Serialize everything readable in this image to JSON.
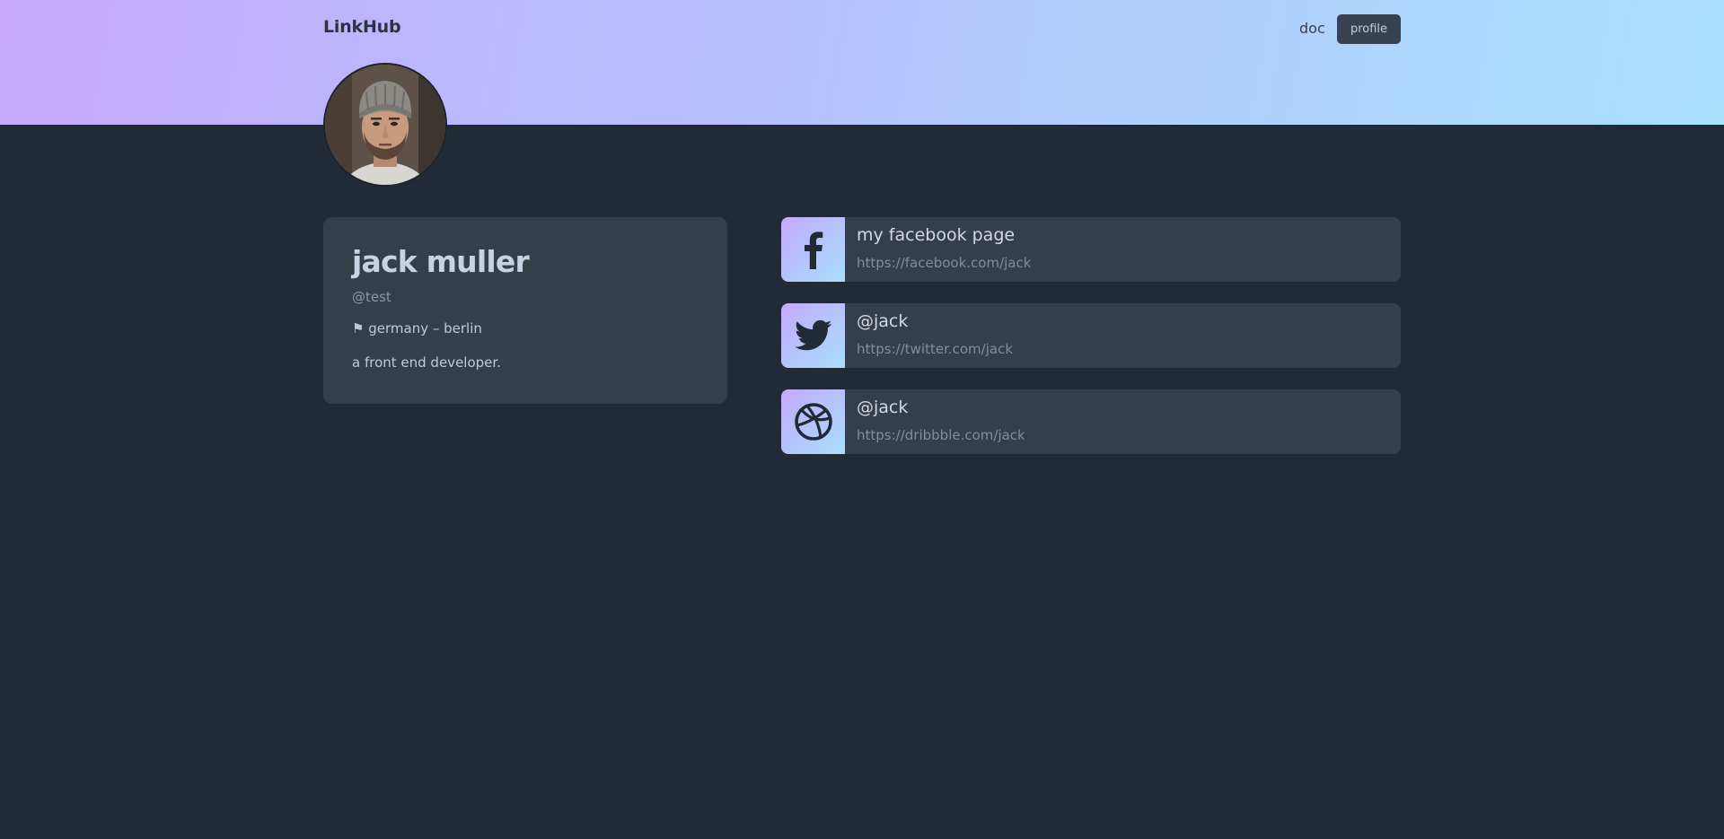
{
  "header": {
    "brand": "LinkHub",
    "nav_doc": "doc",
    "nav_profile": "profile"
  },
  "profile": {
    "name": "jack muller",
    "handle": "@test",
    "location_flag": "⚑",
    "location": "germany – berlin",
    "bio": "a front end developer."
  },
  "links": [
    {
      "icon": "facebook-icon",
      "title": "my facebook page",
      "url": "https://facebook.com/jack"
    },
    {
      "icon": "twitter-icon",
      "title": "@jack",
      "url": "https://twitter.com/jack"
    },
    {
      "icon": "dribbble-icon",
      "title": "@jack",
      "url": "https://dribbble.com/jack"
    }
  ],
  "colors": {
    "background": "#212a35",
    "card": "#363e49",
    "header_gradient_start": "#c5aafb",
    "header_gradient_end": "#a9e1fd",
    "icon_dark": "#212a35"
  }
}
